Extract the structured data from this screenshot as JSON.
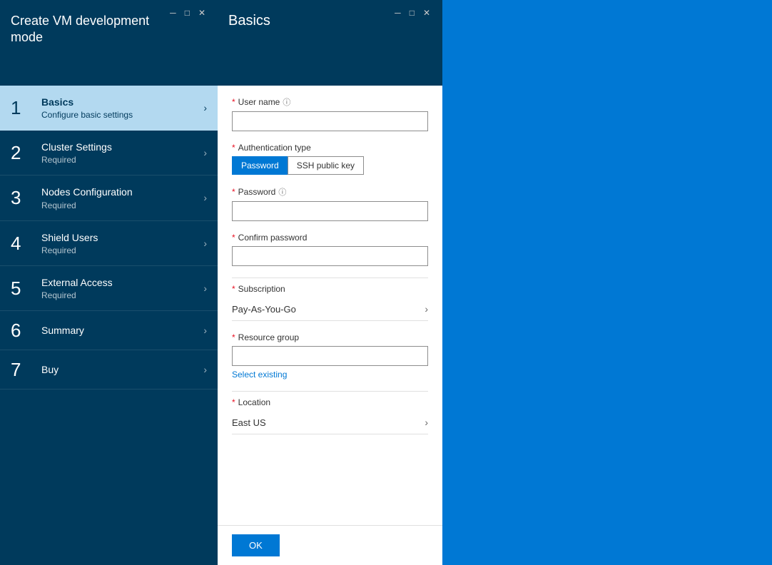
{
  "left_window": {
    "title": "Create VM development mode",
    "controls": [
      "─",
      "□",
      "✕"
    ],
    "nav_items": [
      {
        "number": "1",
        "title": "Basics",
        "subtitle": "Configure basic settings",
        "active": true
      },
      {
        "number": "2",
        "title": "Cluster Settings",
        "subtitle": "Required",
        "active": false
      },
      {
        "number": "3",
        "title": "Nodes Configuration",
        "subtitle": "Required",
        "active": false
      },
      {
        "number": "4",
        "title": "Shield Users",
        "subtitle": "Required",
        "active": false
      },
      {
        "number": "5",
        "title": "External Access",
        "subtitle": "Required",
        "active": false
      },
      {
        "number": "6",
        "title": "Summary",
        "subtitle": "",
        "active": false
      },
      {
        "number": "7",
        "title": "Buy",
        "subtitle": "",
        "active": false
      }
    ]
  },
  "right_window": {
    "title": "Basics",
    "controls": [
      "─",
      "□",
      "✕"
    ]
  },
  "form": {
    "user_name_label": "User name",
    "user_name_value": "",
    "auth_type_label": "Authentication type",
    "auth_password_label": "Password",
    "auth_ssh_label": "SSH public key",
    "password_label": "Password",
    "password_value": "",
    "confirm_password_label": "Confirm password",
    "confirm_password_value": "",
    "subscription_label": "Subscription",
    "subscription_value": "Pay-As-You-Go",
    "resource_group_label": "Resource group",
    "resource_group_value": "",
    "select_existing_label": "Select existing",
    "location_label": "Location",
    "location_value": "East US",
    "ok_button_label": "OK",
    "required_star": "*",
    "info_icon": "ⓘ"
  }
}
